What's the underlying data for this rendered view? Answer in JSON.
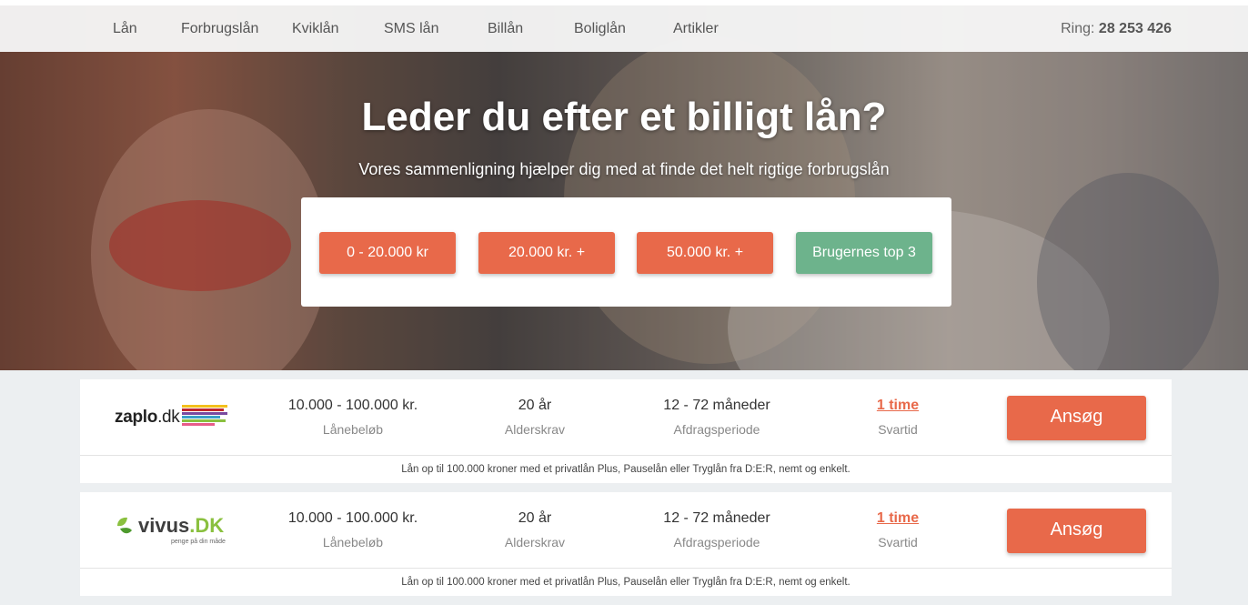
{
  "nav": {
    "items": [
      "Lån",
      "Forbrugslån",
      "Kviklån",
      "SMS lån",
      "Billån",
      "Boliglån",
      "Artikler"
    ],
    "phone_label": "Ring:",
    "phone_number": "28 253 426"
  },
  "hero": {
    "title": "Leder du efter et billigt lån?",
    "subtitle": "Vores sammenligning hjælper dig med at finde det helt rigtige forbrugslån",
    "filters": [
      "0 - 20.000 kr",
      "20.000 kr. +",
      "50.000 kr. +",
      "Brugernes top 3"
    ]
  },
  "colors": {
    "accent": "#e8694a",
    "green": "#6db38c"
  },
  "lenders": [
    {
      "logo_main": "zaplo",
      "logo_suffix": ".dk",
      "amount": "10.000 - 100.000 kr.",
      "amount_label": "Lånebeløb",
      "age": "20 år",
      "age_label": "Alderskrav",
      "period": "12 - 72 måneder",
      "period_label": "Afdragsperiode",
      "response": "1 time",
      "response_label": "Svartid",
      "apply": "Ansøg",
      "description": "Lån op til 100.000 kroner med et privatlån Plus, Pauselån eller Tryglån fra D:E:R, nemt og enkelt."
    },
    {
      "logo_main": "vivus",
      "logo_suffix": ".DK",
      "logo_tagline": "penge på din måde",
      "amount": "10.000 - 100.000 kr.",
      "amount_label": "Lånebeløb",
      "age": "20 år",
      "age_label": "Alderskrav",
      "period": "12 - 72 måneder",
      "period_label": "Afdragsperiode",
      "response": "1 time",
      "response_label": "Svartid",
      "apply": "Ansøg",
      "description": "Lån op til 100.000 kroner med et privatlån Plus, Pauselån eller Tryglån fra D:E:R, nemt og enkelt."
    }
  ]
}
